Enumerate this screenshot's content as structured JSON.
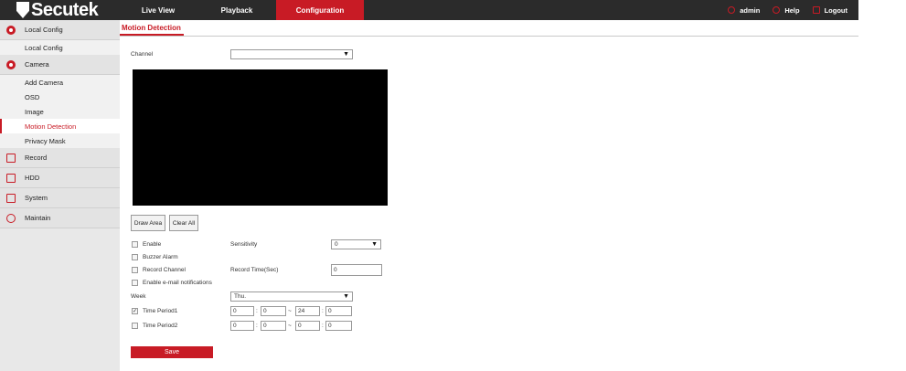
{
  "brand": {
    "name": "Secutek"
  },
  "nav": {
    "items": [
      "Live View",
      "Playback",
      "Configuration"
    ]
  },
  "header_right": {
    "user": "admin",
    "help": "Help",
    "logout": "Logout"
  },
  "sidebar": {
    "local_config": {
      "label": "Local Config",
      "items": [
        "Local Config"
      ]
    },
    "camera": {
      "label": "Camera",
      "items": [
        "Add Camera",
        "OSD",
        "Image",
        "Motion Detection",
        "Privacy Mask"
      ]
    },
    "groups": [
      "Record",
      "HDD",
      "System",
      "Maintain"
    ]
  },
  "main": {
    "tab": "Motion Detection",
    "channel_label": "Channel",
    "channel_value": "",
    "buttons": {
      "draw_area": "Draw Area",
      "clear_all": "Clear All"
    },
    "enable": "Enable",
    "buzzer_alarm": "Buzzer Alarm",
    "record_channel": "Record Channel",
    "email": "Enable e-mail notifications",
    "sensitivity_label": "Sensitivity",
    "sensitivity_value": "0",
    "record_time_label": "Record Time(Sec)",
    "record_time_value": "0",
    "week_label": "Week",
    "week_value": "Thu.",
    "period1_label": "Time Period1",
    "period1_checked": "✓",
    "period1": [
      "0",
      "0",
      "24",
      "0"
    ],
    "period2_label": "Time Period2",
    "period2": [
      "0",
      "0",
      "0",
      "0"
    ],
    "colon": ":",
    "tilde": "~",
    "save": "Save"
  }
}
